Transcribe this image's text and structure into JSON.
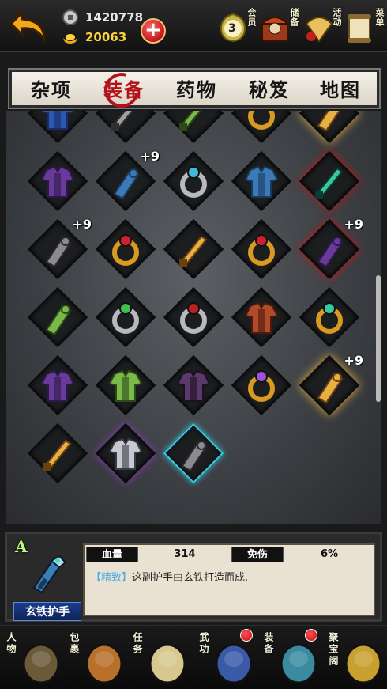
{
  "header": {
    "back_icon": "back-arrow-icon",
    "silver_value": "1420778",
    "gold_value": "20063",
    "add_label": "+",
    "vip_level": "3",
    "vip_label": "会员",
    "store_label": "储备",
    "event_label": "活动",
    "menu_label": "菜单"
  },
  "tabs": [
    {
      "label": "杂项",
      "active": false
    },
    {
      "label": "装备",
      "active": true
    },
    {
      "label": "药物",
      "active": false
    },
    {
      "label": "秘笈",
      "active": false
    },
    {
      "label": "地图",
      "active": false
    }
  ],
  "grid": {
    "items": [
      {
        "name": "blue-robe-icon",
        "plus": "",
        "glow": ""
      },
      {
        "name": "sword-icon",
        "plus": "",
        "glow": ""
      },
      {
        "name": "green-sword-icon",
        "plus": "",
        "glow": ""
      },
      {
        "name": "jade-ring-icon",
        "plus": "",
        "glow": ""
      },
      {
        "name": "golden-claw-icon",
        "plus": "",
        "glow": "gold"
      },
      {
        "name": "purple-armor-icon",
        "plus": "",
        "glow": ""
      },
      {
        "name": "blue-bracer-icon",
        "plus": "+9",
        "glow": ""
      },
      {
        "name": "silver-ring-icon",
        "plus": "",
        "glow": ""
      },
      {
        "name": "blue-armor-icon",
        "plus": "",
        "glow": ""
      },
      {
        "name": "jade-blade-icon",
        "plus": "",
        "glow": "red"
      },
      {
        "name": "iron-claw-icon",
        "plus": "+9",
        "glow": ""
      },
      {
        "name": "ruby-ring-icon",
        "plus": "",
        "glow": ""
      },
      {
        "name": "golden-dagger-icon",
        "plus": "",
        "glow": ""
      },
      {
        "name": "ruby-ring-icon",
        "plus": "",
        "glow": ""
      },
      {
        "name": "purple-gauntlet-icon",
        "plus": "+9",
        "glow": "red"
      },
      {
        "name": "green-bracer-icon",
        "plus": "",
        "glow": ""
      },
      {
        "name": "emerald-ring-icon",
        "plus": "",
        "glow": ""
      },
      {
        "name": "iron-ring-icon",
        "plus": "",
        "glow": ""
      },
      {
        "name": "red-robe-icon",
        "plus": "",
        "glow": ""
      },
      {
        "name": "jade-ring-icon",
        "plus": "",
        "glow": ""
      },
      {
        "name": "purple-robe-icon",
        "plus": "",
        "glow": ""
      },
      {
        "name": "green-robe-icon",
        "plus": "",
        "glow": ""
      },
      {
        "name": "dark-robe-icon",
        "plus": "",
        "glow": ""
      },
      {
        "name": "amethyst-ring-icon",
        "plus": "",
        "glow": ""
      },
      {
        "name": "golden-gauntlet-icon",
        "plus": "+9",
        "glow": "gold"
      },
      {
        "name": "golden-spear-icon",
        "plus": "",
        "glow": ""
      },
      {
        "name": "silver-armor-icon",
        "plus": "",
        "glow": "purple"
      },
      {
        "name": "iron-bracer-icon",
        "plus": "",
        "glow": "",
        "selected": true
      }
    ]
  },
  "detail": {
    "grade": "A",
    "name": "玄铁护手",
    "stat1_label": "血量",
    "stat1_value": "314",
    "stat2_label": "免伤",
    "stat2_value": "6%",
    "desc_tag": "【精致】",
    "desc_text": "这副护手由玄铁打造而成."
  },
  "nav": [
    {
      "label": "人物",
      "icon": "character-icon",
      "badge": false
    },
    {
      "label": "包裹",
      "icon": "bag-icon",
      "badge": false
    },
    {
      "label": "任务",
      "icon": "scroll-icon",
      "badge": false
    },
    {
      "label": "武功",
      "icon": "martial-book-icon",
      "badge": true
    },
    {
      "label": "装备",
      "icon": "equipment-icon",
      "badge": true
    },
    {
      "label": "聚宝阁",
      "icon": "treasure-icon",
      "badge": false
    }
  ],
  "colors": {
    "accent_red": "#b3121a",
    "gold_text": "#ffd23a",
    "grade_green": "#b7ff7a",
    "select_cyan": "#38c8e0"
  }
}
